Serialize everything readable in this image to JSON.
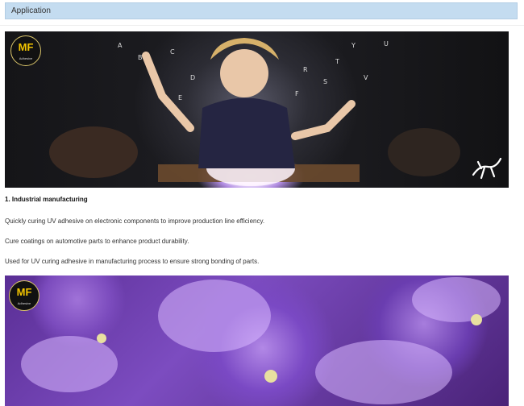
{
  "section": {
    "title": "Application"
  },
  "logo": {
    "text": "MF",
    "tagline": "Adhesive"
  },
  "content": {
    "heading": "1. Industrial manufacturing",
    "paragraphs": [
      "Quickly curing UV adhesive on electronic components to improve production line efficiency.",
      "Cure coatings on automotive parts to enhance product durability.",
      "Used for UV curing adhesive in manufacturing process to ensure strong bonding of parts."
    ]
  }
}
